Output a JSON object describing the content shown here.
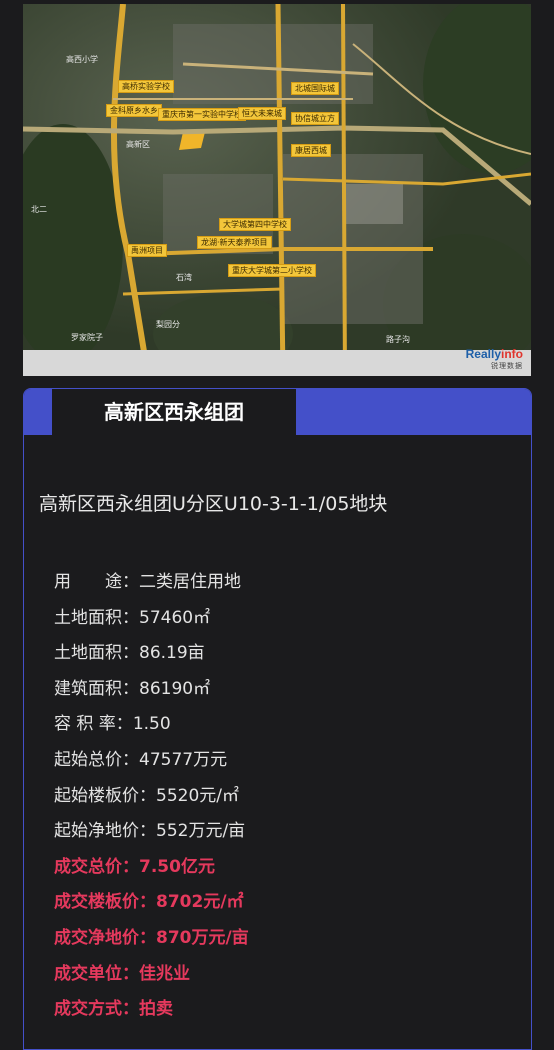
{
  "map": {
    "labels": {
      "school1": "高桥实验学校",
      "school2": "重庆市第一实验中学校",
      "project1": "金科原乡水乡",
      "project2": "恒大未来城",
      "project3": "北城国际城",
      "project4": "协信城立方",
      "project5": "康居西城",
      "school3": "大学城第四中学校",
      "project6": "龙湖·新天泰养项目",
      "project7": "禹洲项目",
      "school4": "重庆大学城第二小学校",
      "place1": "高新区",
      "place2": "高西小学",
      "place3": "罗家院子",
      "place4": "梨园分",
      "place5": "石湾",
      "place6": "北二",
      "place7": "路子沟"
    },
    "watermark_brand_a": "Really",
    "watermark_brand_b": "info",
    "watermark_sub": "锐理数据"
  },
  "card": {
    "tab_label": "高新区西永组团",
    "plot_title": "高新区西永组团U分区U10-3-1-1/05地块",
    "rows": [
      {
        "key": "用　　途：",
        "value": "二类居住用地",
        "highlight": false
      },
      {
        "key": "土地面积：",
        "value": "57460㎡",
        "highlight": false
      },
      {
        "key": "土地面积：",
        "value": "86.19亩",
        "highlight": false
      },
      {
        "key": "建筑面积：",
        "value": "86190㎡",
        "highlight": false
      },
      {
        "key": "容  积  率：",
        "value": "1.50",
        "highlight": false
      },
      {
        "key": "起始总价：",
        "value": "47577万元",
        "highlight": false
      },
      {
        "key": "起始楼板价：",
        "value": "5520元/㎡",
        "highlight": false
      },
      {
        "key": "起始净地价：",
        "value": "552万元/亩",
        "highlight": false
      },
      {
        "key": "成交总价：",
        "value": "7.50亿元",
        "highlight": true
      },
      {
        "key": "成交楼板价：",
        "value": "8702元/㎡",
        "highlight": true
      },
      {
        "key": "成交净地价：",
        "value": "870万元/亩",
        "highlight": true
      },
      {
        "key": "成交单位：",
        "value": "佳兆业",
        "highlight": true
      },
      {
        "key": "成交方式：",
        "value": "拍卖",
        "highlight": true
      }
    ]
  },
  "colors": {
    "accent": "#4450c9",
    "highlight": "#e5395d",
    "background": "#1b1b1d"
  }
}
